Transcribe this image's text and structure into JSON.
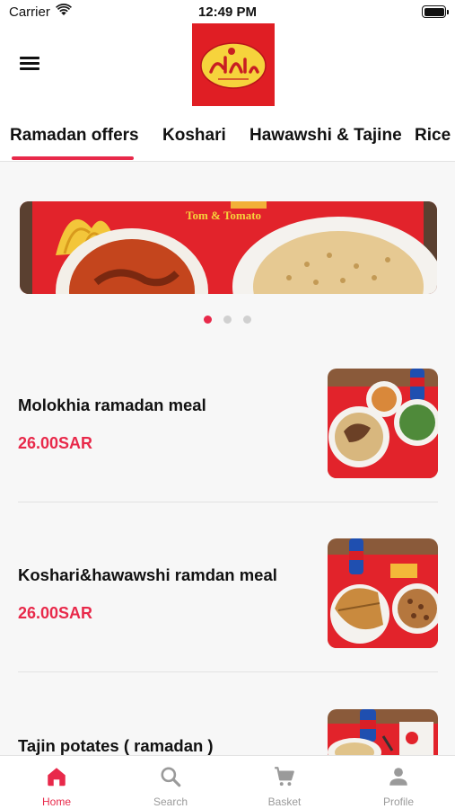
{
  "status_bar": {
    "carrier": "Carrier",
    "time": "12:49 PM"
  },
  "header": {
    "logo_icon": "brand-logo-icon",
    "menu_icon": "hamburger-menu-icon"
  },
  "tabs": [
    {
      "label": "Ramadan offers",
      "active": true
    },
    {
      "label": "Koshari",
      "active": false
    },
    {
      "label": "Hawawshi & Tajine",
      "active": false
    },
    {
      "label": "Rice d",
      "active": false
    }
  ],
  "banner": {
    "text": "Tom & Tomato"
  },
  "carousel": {
    "count": 3,
    "active_index": 0
  },
  "items": [
    {
      "name": "Molokhia ramadan meal",
      "price": "26.00SAR"
    },
    {
      "name": "Koshari&hawawshi ramdan meal",
      "price": "26.00SAR"
    },
    {
      "name": "Tajin potates ( ramadan )",
      "price": ""
    }
  ],
  "bottom_nav": [
    {
      "label": "Home",
      "icon": "home-icon",
      "active": true
    },
    {
      "label": "Search",
      "icon": "search-icon",
      "active": false
    },
    {
      "label": "Basket",
      "icon": "cart-icon",
      "active": false
    },
    {
      "label": "Profile",
      "icon": "person-icon",
      "active": false
    }
  ],
  "colors": {
    "accent": "#e8294a",
    "brand_red": "#e01e24",
    "brand_yellow": "#f6d33c"
  }
}
